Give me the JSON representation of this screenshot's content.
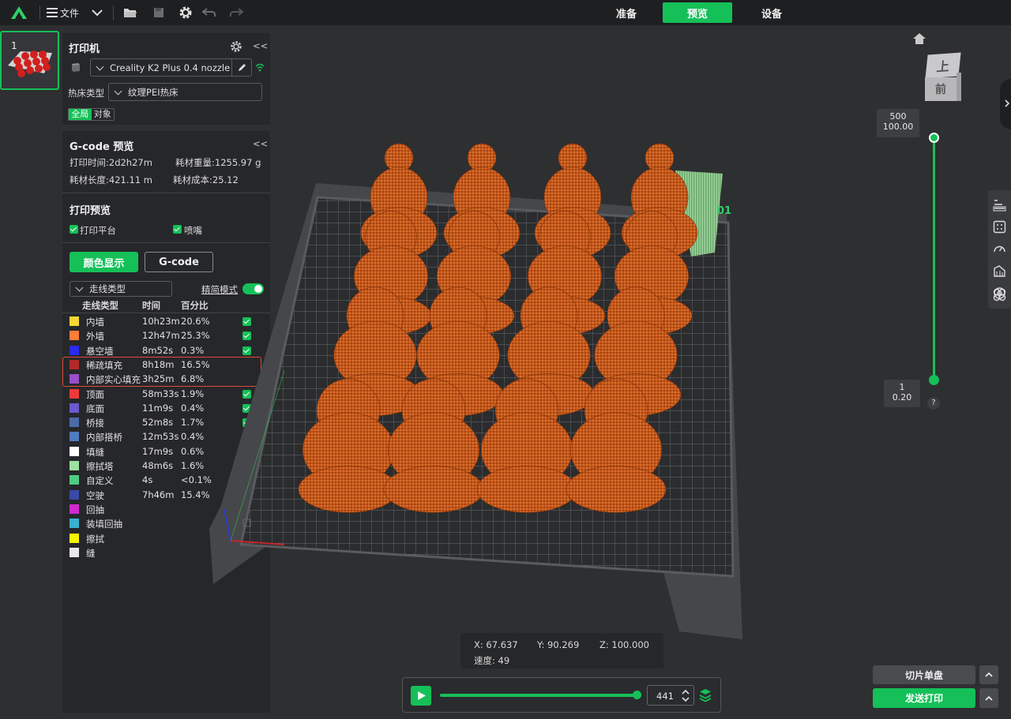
{
  "topbar": {
    "file_label": "文件",
    "tabs": [
      {
        "label": "准备",
        "active": false
      },
      {
        "label": "预览",
        "active": true
      },
      {
        "label": "设备",
        "active": false
      }
    ]
  },
  "thumbnail": {
    "index": "1"
  },
  "printer_panel": {
    "title": "打印机",
    "collapse": "<<",
    "printer_name": "Creality K2 Plus 0.4 nozzle",
    "bed_label": "热床类型",
    "bed_value": "纹理PEI热床",
    "scope_tabs": [
      "全局",
      "对象"
    ]
  },
  "gcode_panel": {
    "title": "G-code 预览",
    "collapse": "<<",
    "print_time": "打印时间:2d2h27m",
    "filament_weight": "耗材重量:1255.97 g",
    "filament_length": "耗材长度:421.11 m",
    "filament_cost": "耗材成本:25.12",
    "preview_title": "打印预览",
    "opt_bed": "打印平台",
    "opt_nozzle": "喷嘴",
    "btn_color": "颜色显示",
    "btn_gcode": "G-code",
    "line_type_select": "走线类型",
    "simple_mode": "精简模式",
    "col_type": "走线类型",
    "col_time": "时间",
    "col_pct": "百分比",
    "rows": [
      {
        "name": "内墙",
        "time": "10h23m",
        "pct": "20.6%",
        "color": "#f5d633",
        "checked": true
      },
      {
        "name": "外墙",
        "time": "12h47m",
        "pct": "25.3%",
        "color": "#ff7d38",
        "checked": true
      },
      {
        "name": "悬空墙",
        "time": "8m52s",
        "pct": "0.3%",
        "color": "#2a2af0",
        "checked": true
      },
      {
        "name": "稀疏填充",
        "time": "8h18m",
        "pct": "16.5%",
        "color": "#b22a28",
        "checked": false
      },
      {
        "name": "内部实心填充",
        "time": "3h25m",
        "pct": "6.8%",
        "color": "#9a4fc8",
        "checked": false
      },
      {
        "name": "顶面",
        "time": "58m33s",
        "pct": "1.9%",
        "color": "#f03a3a",
        "checked": true
      },
      {
        "name": "底面",
        "time": "11m9s",
        "pct": "0.4%",
        "color": "#6a5ad0",
        "checked": true
      },
      {
        "name": "桥接",
        "time": "52m8s",
        "pct": "1.7%",
        "color": "#4d6aa8",
        "checked": true
      },
      {
        "name": "内部搭桥",
        "time": "12m53s",
        "pct": "0.4%",
        "color": "#4e7cc0",
        "checked": false
      },
      {
        "name": "填缝",
        "time": "17m9s",
        "pct": "0.6%",
        "color": "#ffffff",
        "checked": true
      },
      {
        "name": "擦拭塔",
        "time": "48m6s",
        "pct": "1.6%",
        "color": "#9ee0a0",
        "checked": true
      },
      {
        "name": "自定义",
        "time": "4s",
        "pct": "<0.1%",
        "color": "#4ecb84",
        "checked": true
      },
      {
        "name": "空驶",
        "time": "7h46m",
        "pct": "15.4%",
        "color": "#3a4aa8",
        "checked": false
      },
      {
        "name": "回抽",
        "time": "",
        "pct": "",
        "color": "#d02ad0",
        "checked": false
      },
      {
        "name": "装填回抽",
        "time": "",
        "pct": "",
        "color": "#3ab0d0",
        "checked": false
      },
      {
        "name": "擦拭",
        "time": "",
        "pct": "",
        "color": "#f5f500",
        "checked": false
      },
      {
        "name": "缝",
        "time": "",
        "pct": "",
        "color": "#e8e8e8",
        "checked": true
      }
    ]
  },
  "viewcube": {
    "top": "上",
    "front": "前"
  },
  "layer_slider": {
    "top_layer": "500",
    "top_height": "100.00",
    "bottom_layer": "1",
    "bottom_height": "0.20",
    "help": "?"
  },
  "plate_label": "01",
  "coords": {
    "x": "X: 67.637",
    "y": "Y: 90.269",
    "z": "Z: 100.000",
    "speed": "速度: 49"
  },
  "playback": {
    "move_value": "441",
    "progress": 1.0
  },
  "slice_button": "切片单盘",
  "send_button": "发送打印",
  "colors": {
    "accent": "#15c058",
    "model": "#c2571c",
    "highlight": "#e04a3a"
  }
}
